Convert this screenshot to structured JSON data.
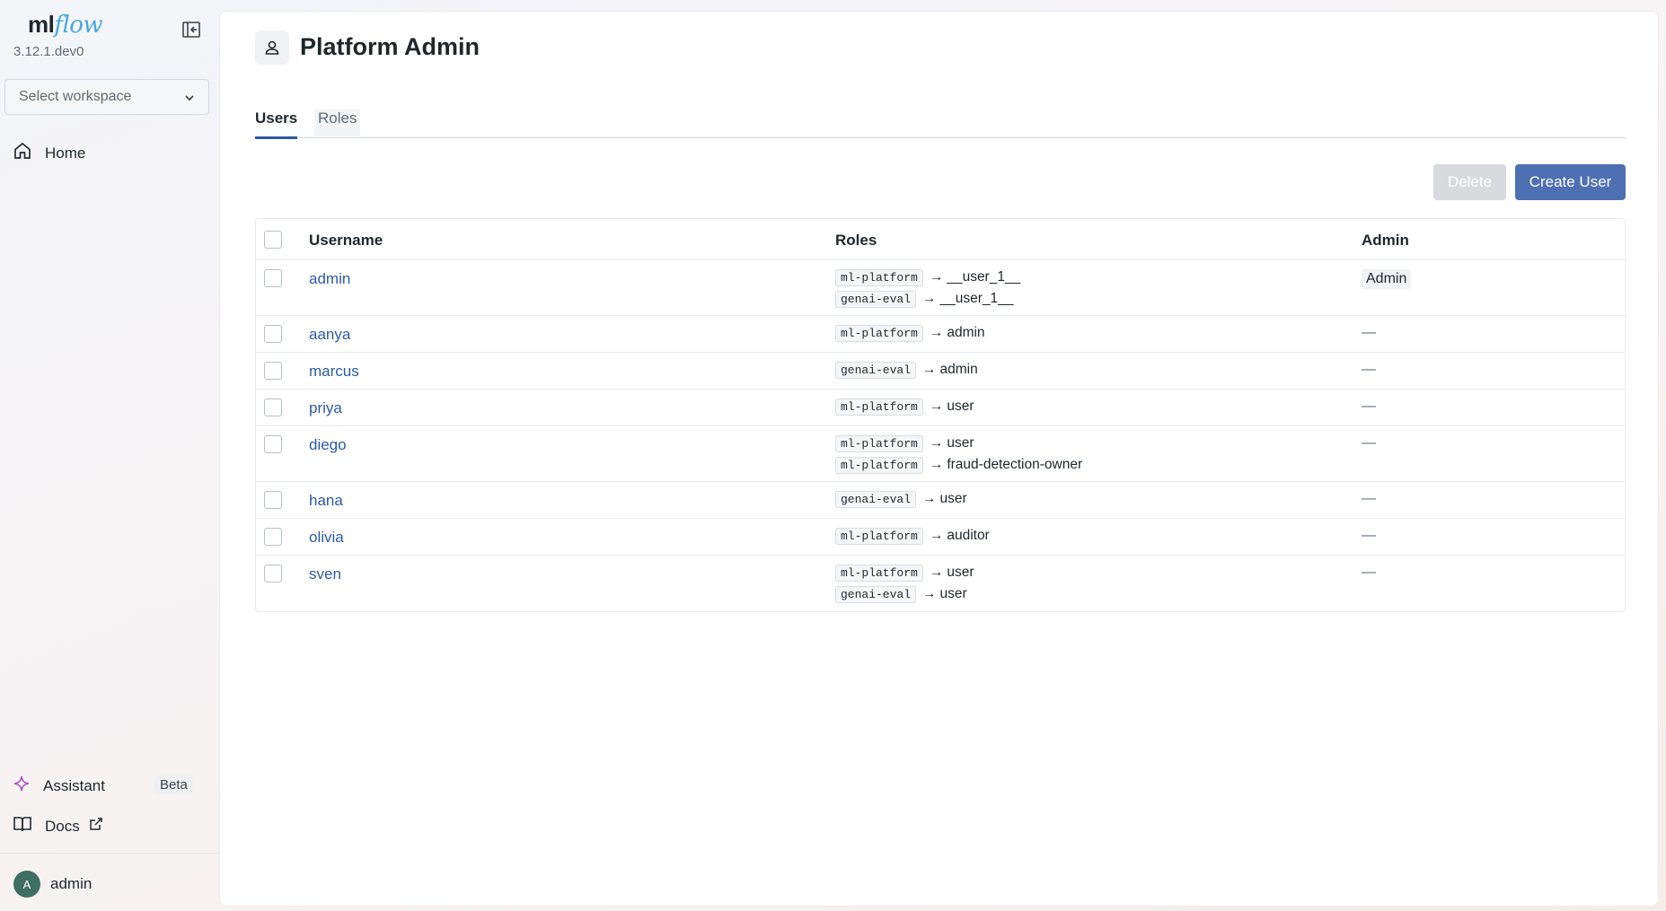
{
  "sidebar": {
    "logo_ml": "ml",
    "logo_flow": "flow",
    "version": "3.12.1.dev0",
    "workspace_placeholder": "Select workspace",
    "home_label": "Home",
    "assistant_label": "Assistant",
    "beta_label": "Beta",
    "docs_label": "Docs",
    "user_initial": "A",
    "user_name": "admin"
  },
  "page": {
    "title": "Platform Admin",
    "tabs": [
      {
        "label": "Users"
      },
      {
        "label": "Roles"
      }
    ],
    "delete_label": "Delete",
    "create_label": "Create User"
  },
  "table": {
    "headers": {
      "username": "Username",
      "roles": "Roles",
      "admin": "Admin"
    },
    "rows": [
      {
        "username": "admin",
        "roles": [
          {
            "ws": "ml-platform",
            "role": "__user_1__"
          },
          {
            "ws": "genai-eval",
            "role": "__user_1__"
          }
        ],
        "admin": "Admin"
      },
      {
        "username": "aanya",
        "roles": [
          {
            "ws": "ml-platform",
            "role": "admin"
          }
        ],
        "admin": "—"
      },
      {
        "username": "marcus",
        "roles": [
          {
            "ws": "genai-eval",
            "role": "admin"
          }
        ],
        "admin": "—"
      },
      {
        "username": "priya",
        "roles": [
          {
            "ws": "ml-platform",
            "role": "user"
          }
        ],
        "admin": "—"
      },
      {
        "username": "diego",
        "roles": [
          {
            "ws": "ml-platform",
            "role": "user"
          },
          {
            "ws": "ml-platform",
            "role": "fraud-detection-owner"
          }
        ],
        "admin": "—"
      },
      {
        "username": "hana",
        "roles": [
          {
            "ws": "genai-eval",
            "role": "user"
          }
        ],
        "admin": "—"
      },
      {
        "username": "olivia",
        "roles": [
          {
            "ws": "ml-platform",
            "role": "auditor"
          }
        ],
        "admin": "—"
      },
      {
        "username": "sven",
        "roles": [
          {
            "ws": "ml-platform",
            "role": "user"
          },
          {
            "ws": "genai-eval",
            "role": "user"
          }
        ],
        "admin": "—"
      }
    ]
  },
  "colors": {
    "accent": "#2c5aa8",
    "primary_button": "#4e6fb1",
    "disabled_button": "#d8dadd"
  }
}
